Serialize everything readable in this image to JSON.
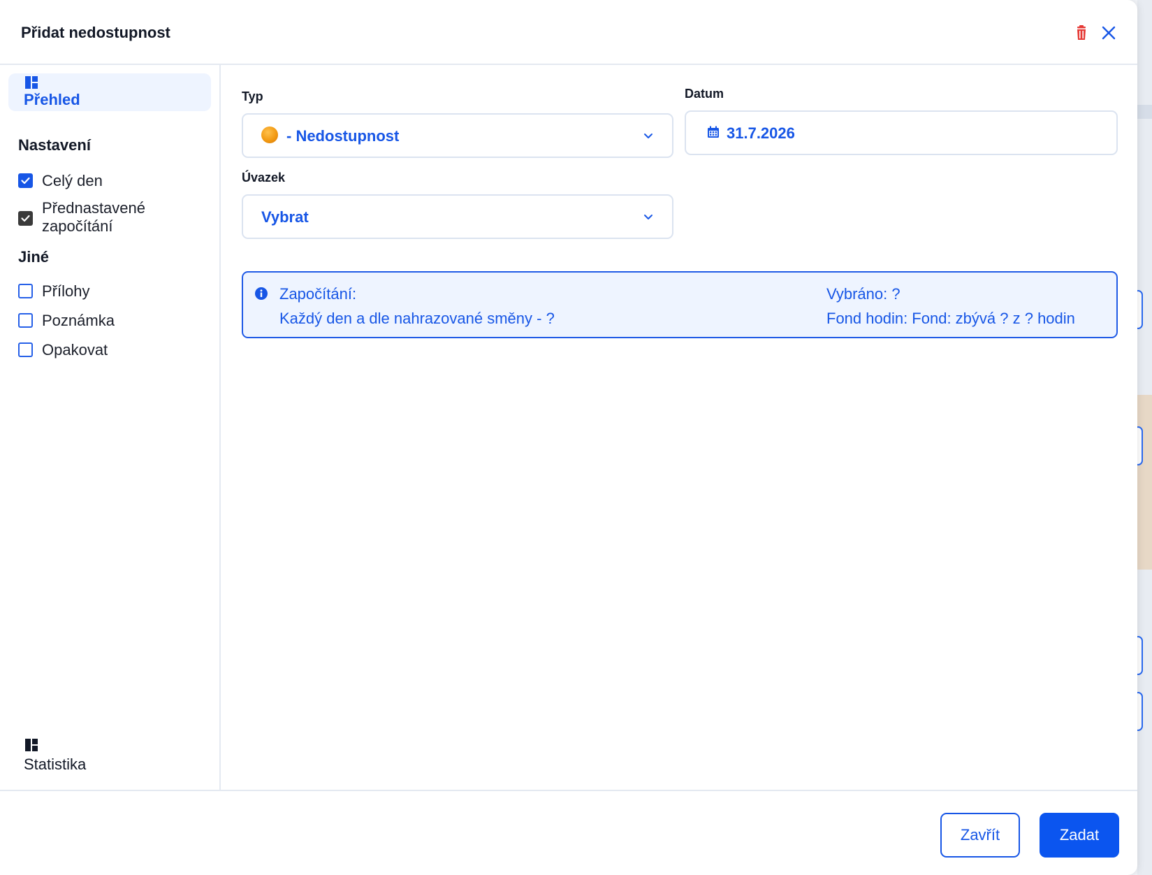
{
  "dialog": {
    "title": "Přidat nedostupnost"
  },
  "header_icons": [
    "trash-icon",
    "close-icon"
  ],
  "sidebar": {
    "overview_label": "Přehled",
    "settings_heading": "Nastavení",
    "settings": [
      {
        "label": "Celý den",
        "checked": true
      },
      {
        "label": "Přednastavené",
        "label2": "započítání",
        "checked": true
      }
    ],
    "other_heading": "Jiné",
    "other": [
      {
        "label": "Přílohy",
        "checked": false
      },
      {
        "label": "Poznámka",
        "checked": false
      },
      {
        "label": "Opakovat",
        "checked": false
      }
    ],
    "stats_label": "Statistika"
  },
  "form": {
    "type_label": "Typ",
    "type_value": "- Nedostupnost",
    "date_label": "Datum",
    "date_value": "31.7.2026",
    "contract_label": "Úvazek",
    "contract_value": "Vybrat"
  },
  "info": {
    "counting_label": "Započítání:",
    "counting_value": "Každý den a dle nahrazované směny - ?",
    "selected": "Vybráno: ?",
    "fund": "Fond hodin: Fond: zbývá ? z ? hodin"
  },
  "footer": {
    "close_label": "Zavřít",
    "submit_label": "Zadat"
  },
  "colors": {
    "accent": "#1756e6",
    "danger": "#e53935",
    "status_dot": "#f29a12"
  }
}
